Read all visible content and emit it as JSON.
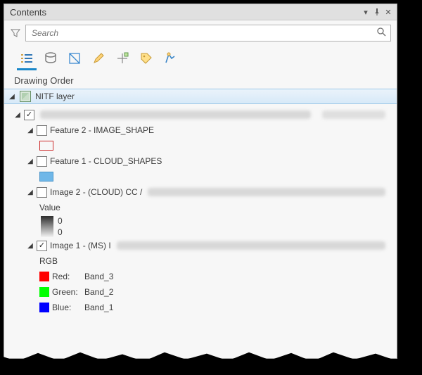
{
  "window": {
    "title": "Contents"
  },
  "search": {
    "placeholder": "Search"
  },
  "section": {
    "heading": "Drawing Order"
  },
  "layer": {
    "name": "NITF layer"
  },
  "tree": {
    "feature2": {
      "label": "Feature 2 - IMAGE_SHAPE"
    },
    "feature1": {
      "label": "Feature 1 - CLOUD_SHAPES"
    },
    "image2": {
      "label_prefix": "Image 2 - (CLOUD) CC /",
      "value_label": "Value",
      "top": "0",
      "bottom": "0"
    },
    "image1": {
      "label_prefix": "Image 1 - (MS) I"
    },
    "rgb": {
      "heading": "RGB",
      "red": {
        "label": "Red:",
        "band": "Band_3"
      },
      "green": {
        "label": "Green:",
        "band": "Band_2"
      },
      "blue": {
        "label": "Blue:",
        "band": "Band_1"
      }
    }
  }
}
